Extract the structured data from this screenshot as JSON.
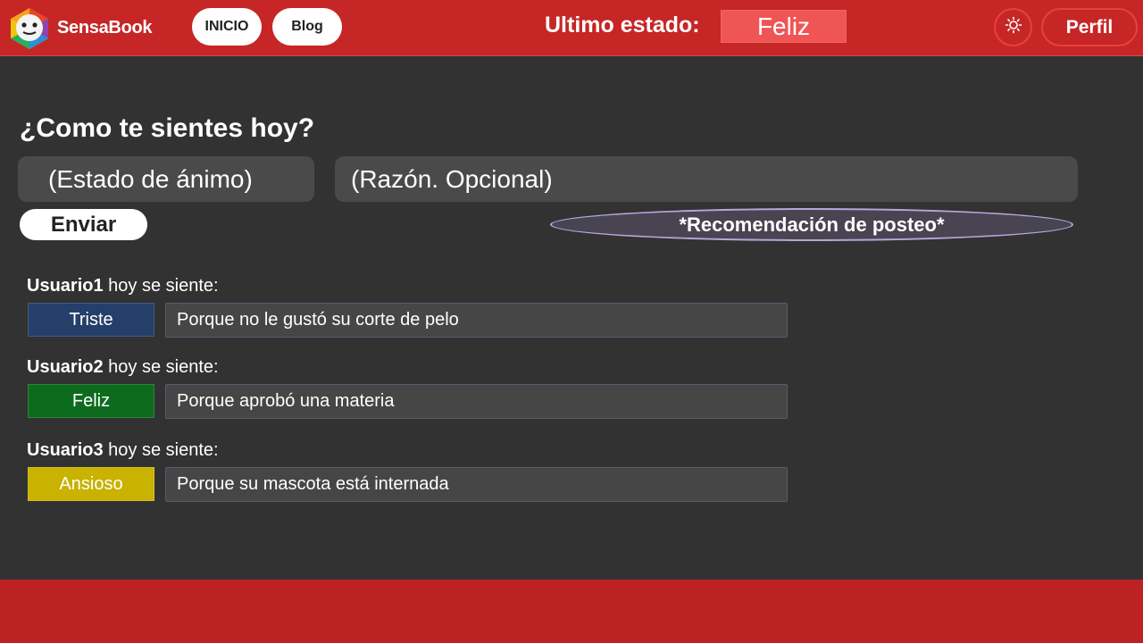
{
  "header": {
    "brand": "SensaBook",
    "nav": {
      "inicio": "INICIO",
      "blog": "Blog"
    },
    "last_state_label": "Ultimo estado:",
    "last_state_value": "Feliz",
    "theme_icon": "sun-icon",
    "profile_label": "Perfil",
    "colors": {
      "bar": "#c62626",
      "last_state_bg": "#f05555"
    }
  },
  "form": {
    "question": "¿Como te sientes hoy?",
    "mood_placeholder": "(Estado de ánimo)",
    "reason_placeholder": "(Razón. Opcional)",
    "send_label": "Enviar",
    "recommend_label": "*Recomendación de posteo*"
  },
  "posts": [
    {
      "user": "Usuario1",
      "suffix": "hoy se siente:",
      "mood": "Triste",
      "mood_color": "#243f6a",
      "reason": "Porque no le gustó su corte de pelo"
    },
    {
      "user": "Usuario2",
      "suffix": "hoy se siente:",
      "mood": "Feliz",
      "mood_color": "#0d6b1e",
      "reason": "Porque aprobó una materia"
    },
    {
      "user": "Usuario3",
      "suffix": "hoy se siente:",
      "mood": "Ansioso",
      "mood_color": "#c9b200",
      "reason": "Porque su mascota está internada"
    }
  ]
}
